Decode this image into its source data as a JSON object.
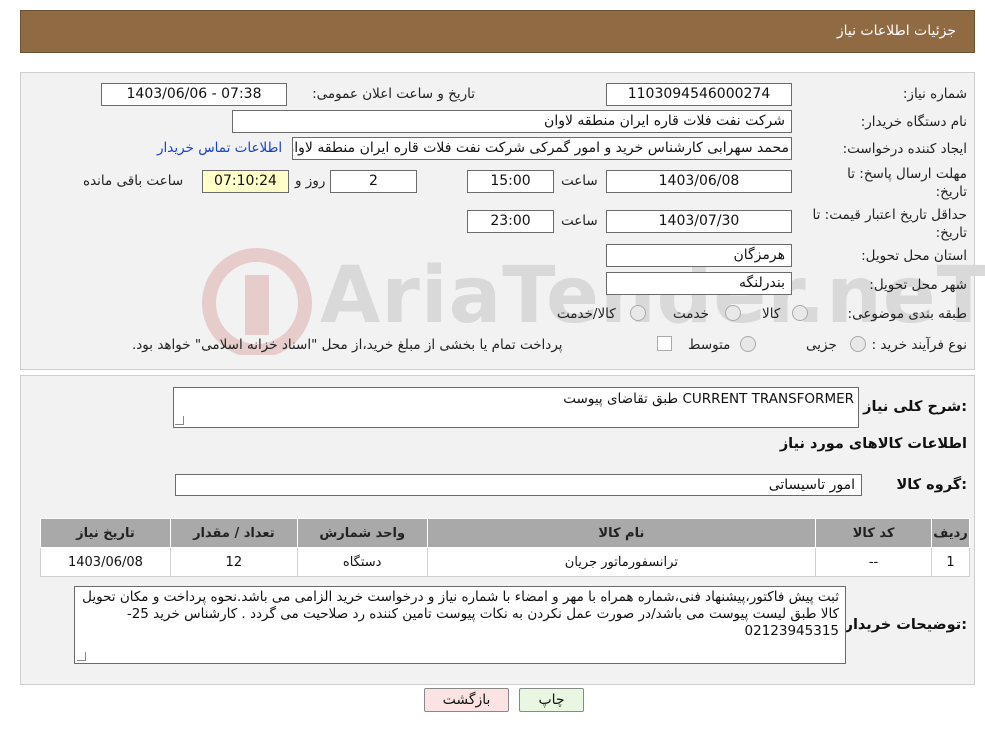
{
  "header": {
    "title": "جزئیات اطلاعات نیاز"
  },
  "form": {
    "need_number_label": "شماره نیاز:",
    "need_number": "1103094546000274",
    "announce_label": "تاریخ و ساعت اعلان عمومی:",
    "announce_value": "1403/06/06 - 07:38",
    "buyer_org_label": "نام دستگاه خریدار:",
    "buyer_org": "شرکت نفت فلات قاره ایران منطقه لاوان",
    "requester_label": "ایجاد کننده درخواست:",
    "requester": "محمد سهرابی کارشناس خرید و امور گمرکی شرکت نفت فلات قاره ایران منطقه لاوان",
    "contact_link": "اطلاعات تماس خریدار",
    "reply_deadline_label_1": "مهلت ارسال پاسخ: تا",
    "reply_deadline_label_2": "تاریخ:",
    "reply_date": "1403/06/08",
    "time_word": "ساعت",
    "reply_time": "15:00",
    "days_value": "2",
    "days_word": "روز و",
    "remaining_time": "07:10:24",
    "remaining_word": "ساعت باقی مانده",
    "price_validity_label_1": "حداقل تاریخ اعتبار قیمت: تا",
    "price_validity_label_2": "تاریخ:",
    "validity_date": "1403/07/30",
    "validity_time": "23:00",
    "province_label": "استان محل تحویل:",
    "province": "هرمزگان",
    "city_label": "شهر محل تحویل:",
    "city": "بندرلنگه",
    "category_label": "طبقه بندی موضوعی:",
    "category_options": [
      "کالا",
      "خدمت",
      "کالا/خدمت"
    ],
    "process_label": "نوع فرآیند خرید :",
    "process_options": [
      "جزیی",
      "متوسط"
    ],
    "payment_note": "پرداخت تمام یا بخشی از مبلغ خرید،از محل \"اسناد خزانه اسلامی\" خواهد بود."
  },
  "description": {
    "label": "شرح کلی نیاز:",
    "value": "CURRENT TRANSFORMER طبق تقاضای پیوست"
  },
  "goods": {
    "section_title": "اطلاعات کالاهای مورد نیاز",
    "group_label": "گروه کالا:",
    "group_value": "امور تاسیساتی"
  },
  "table": {
    "headers": [
      "ردیف",
      "کد کالا",
      "نام کالا",
      "واحد شمارش",
      "تعداد / مقدار",
      "تاریخ نیاز"
    ],
    "rows": [
      [
        "1",
        "--",
        "ترانسفورماتور جریان",
        "دستگاه",
        "12",
        "1403/06/08"
      ]
    ]
  },
  "buyer_notes": {
    "label": "توضیحات خریدار:",
    "value": "ثبت پیش فاکتور،پیشنهاد فنی،شماره همراه با مهر و امضاء با شماره نیاز و درخواست خرید الزامی می باشد.نحوه پرداخت و مکان تحویل کالا طبق لیست پیوست می باشد/در صورت عمل نکردن به نکات پیوست تامین کننده رد صلاحیت می گردد . کارشناس خرید 25-02123945315"
  },
  "buttons": {
    "back": "بازگشت",
    "print": "چاپ"
  },
  "watermark": {
    "text": "AriaTender.neT"
  },
  "colors": {
    "header_bg": "#8f6a43",
    "link": "#1a3fcf",
    "back_button_bg": "#fbe3e3",
    "print_button_bg": "#e8f6e2"
  }
}
